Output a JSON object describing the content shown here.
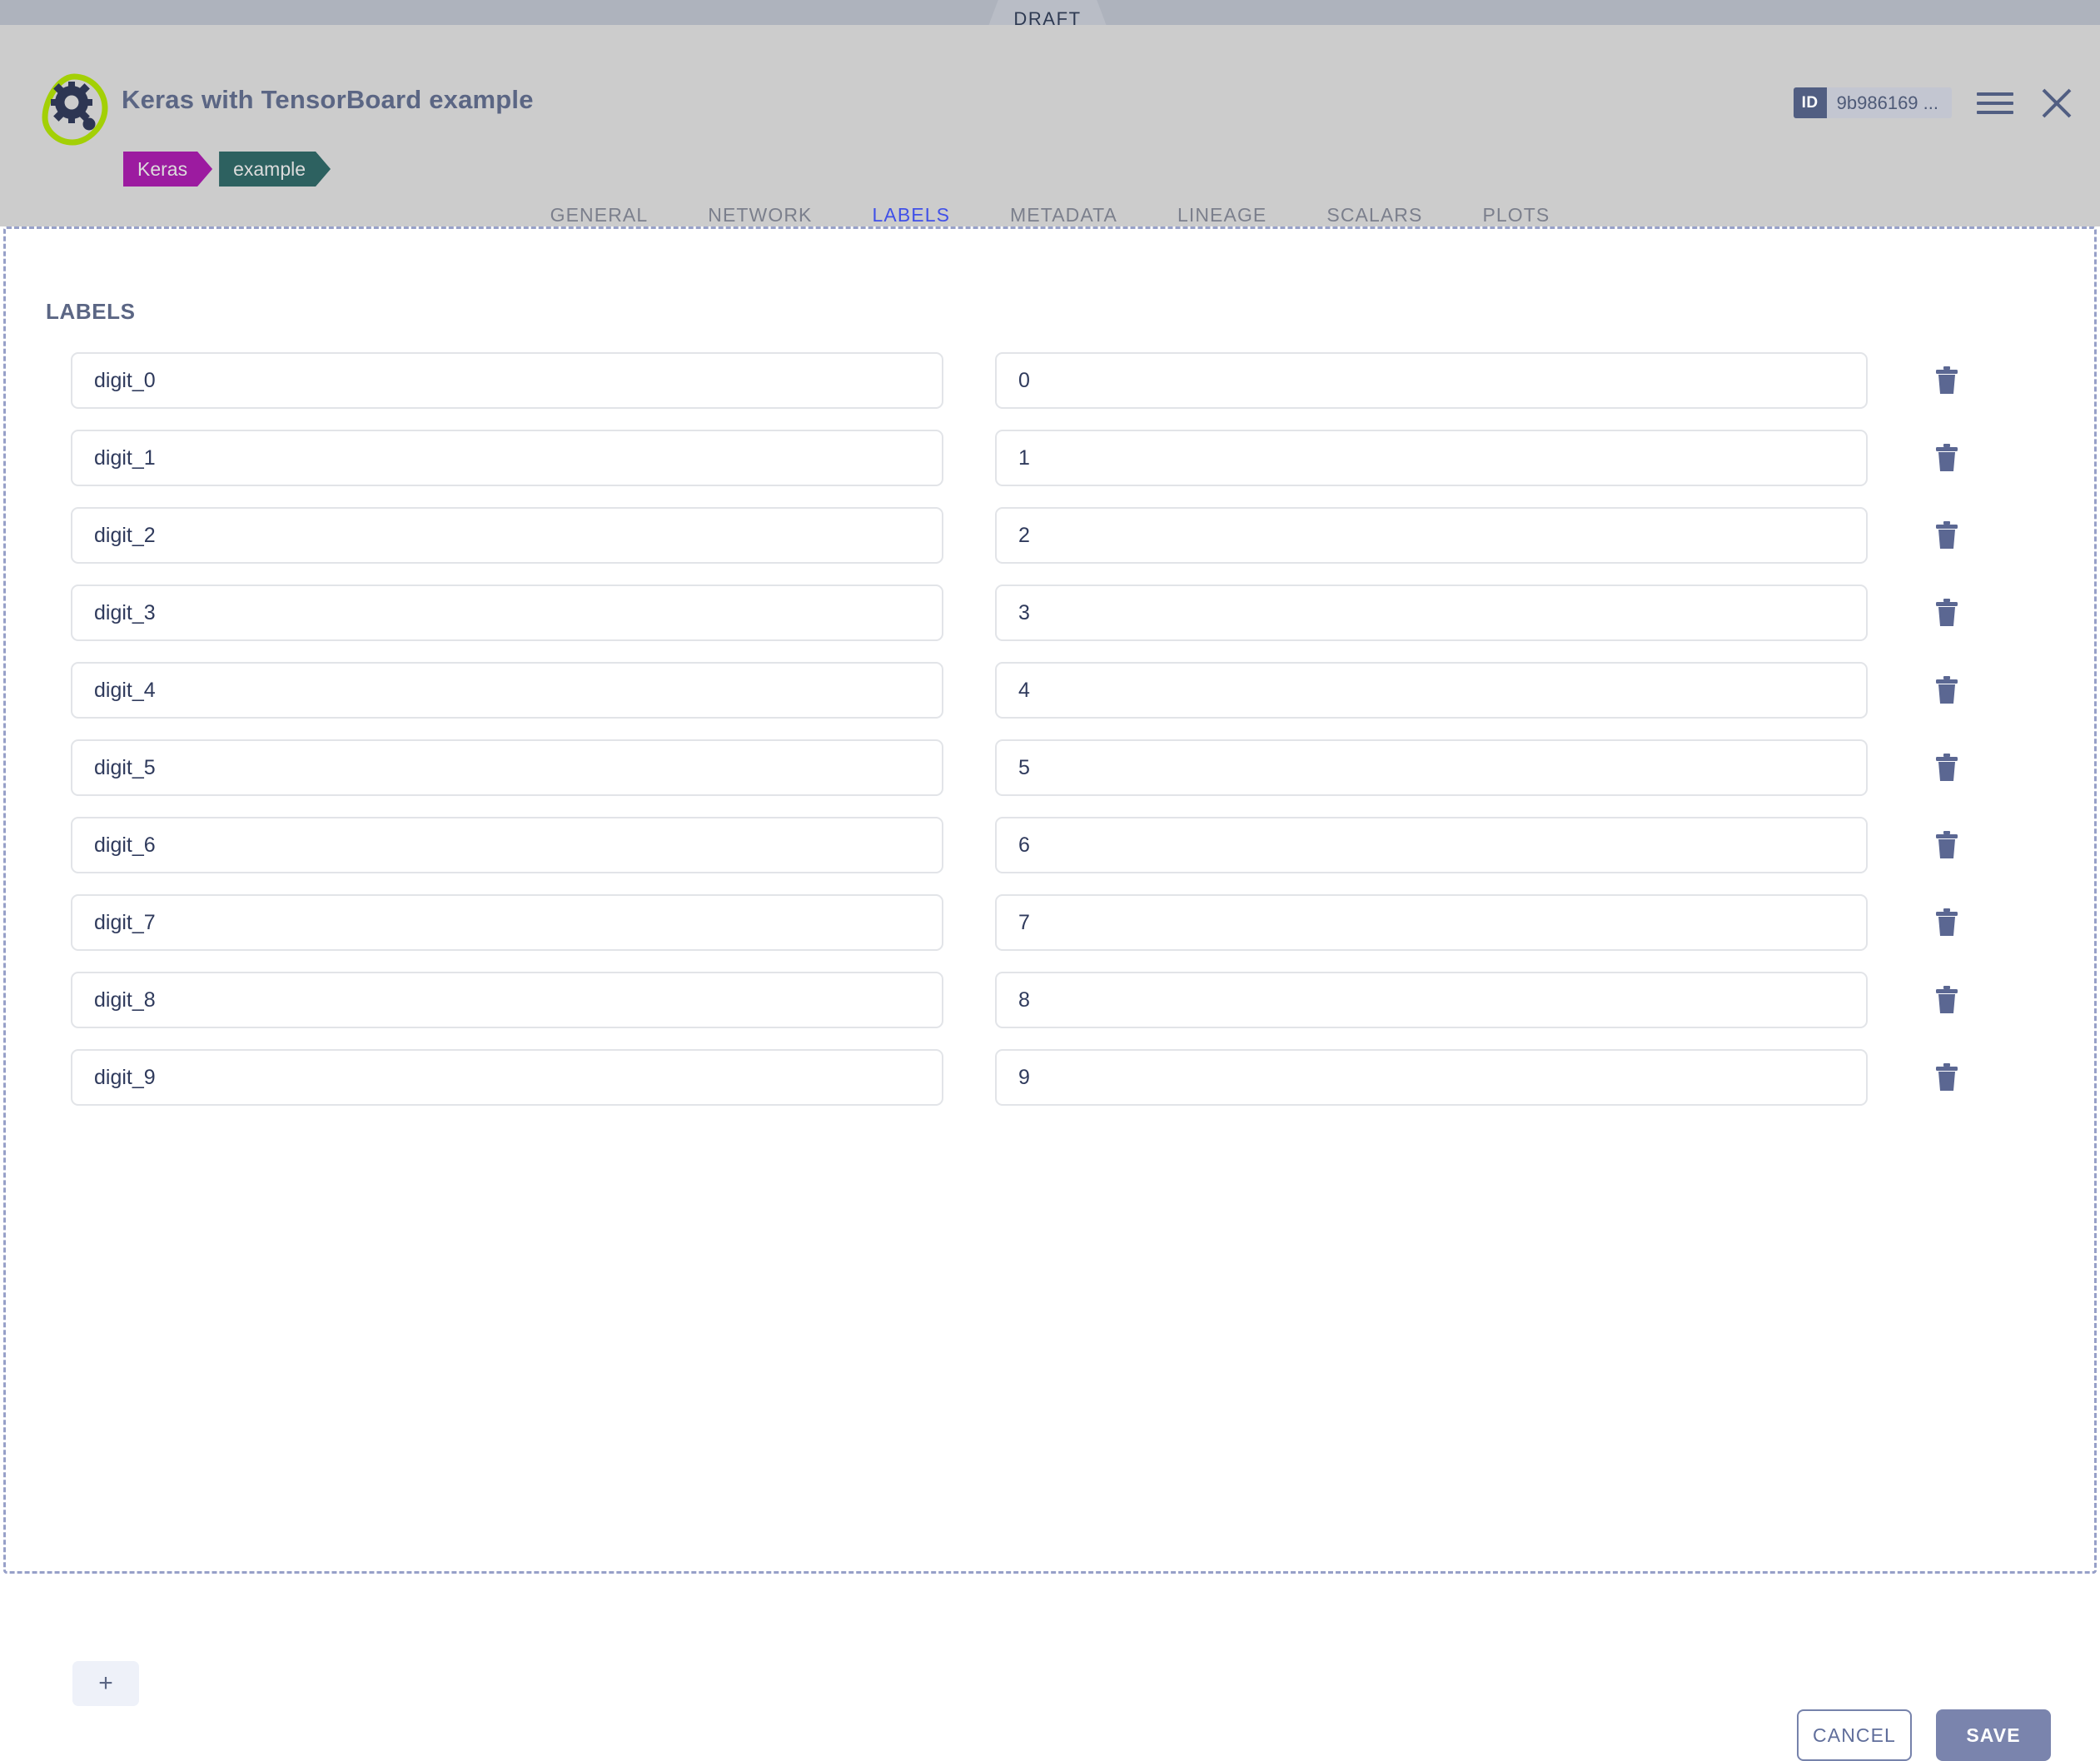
{
  "window": {
    "status_tab": "DRAFT"
  },
  "header": {
    "title": "Keras with TensorBoard example",
    "logo_icon": "gear-teardrop-logo",
    "tags": [
      {
        "label": "Keras",
        "color": "#9c1ba0"
      },
      {
        "label": "example",
        "color": "#2d6160"
      }
    ],
    "id_badge": {
      "key": "ID",
      "value": "9b986169 ..."
    },
    "menu_icon": "hamburger-menu-icon",
    "close_icon": "close-icon"
  },
  "tabs": [
    {
      "label": "GENERAL",
      "active": false
    },
    {
      "label": "NETWORK",
      "active": false
    },
    {
      "label": "LABELS",
      "active": true
    },
    {
      "label": "METADATA",
      "active": false
    },
    {
      "label": "LINEAGE",
      "active": false
    },
    {
      "label": "SCALARS",
      "active": false
    },
    {
      "label": "PLOTS",
      "active": false
    }
  ],
  "main": {
    "section_title": "LABELS",
    "rows": [
      {
        "key": "digit_0",
        "value": "0"
      },
      {
        "key": "digit_1",
        "value": "1"
      },
      {
        "key": "digit_2",
        "value": "2"
      },
      {
        "key": "digit_3",
        "value": "3"
      },
      {
        "key": "digit_4",
        "value": "4"
      },
      {
        "key": "digit_5",
        "value": "5"
      },
      {
        "key": "digit_6",
        "value": "6"
      },
      {
        "key": "digit_7",
        "value": "7"
      },
      {
        "key": "digit_8",
        "value": "8"
      },
      {
        "key": "digit_9",
        "value": "9"
      }
    ],
    "delete_icon": "trash-icon",
    "add_label": "+"
  },
  "footer": {
    "cancel_label": "CANCEL",
    "save_label": "SAVE"
  },
  "colors": {
    "accent": "#4050e8",
    "primary": "#5b6684",
    "save_bg": "#7a84ad",
    "header_bg": "#cccccc",
    "strip_bg": "#aeb3bd",
    "border_dashed": "#97a0c8"
  }
}
